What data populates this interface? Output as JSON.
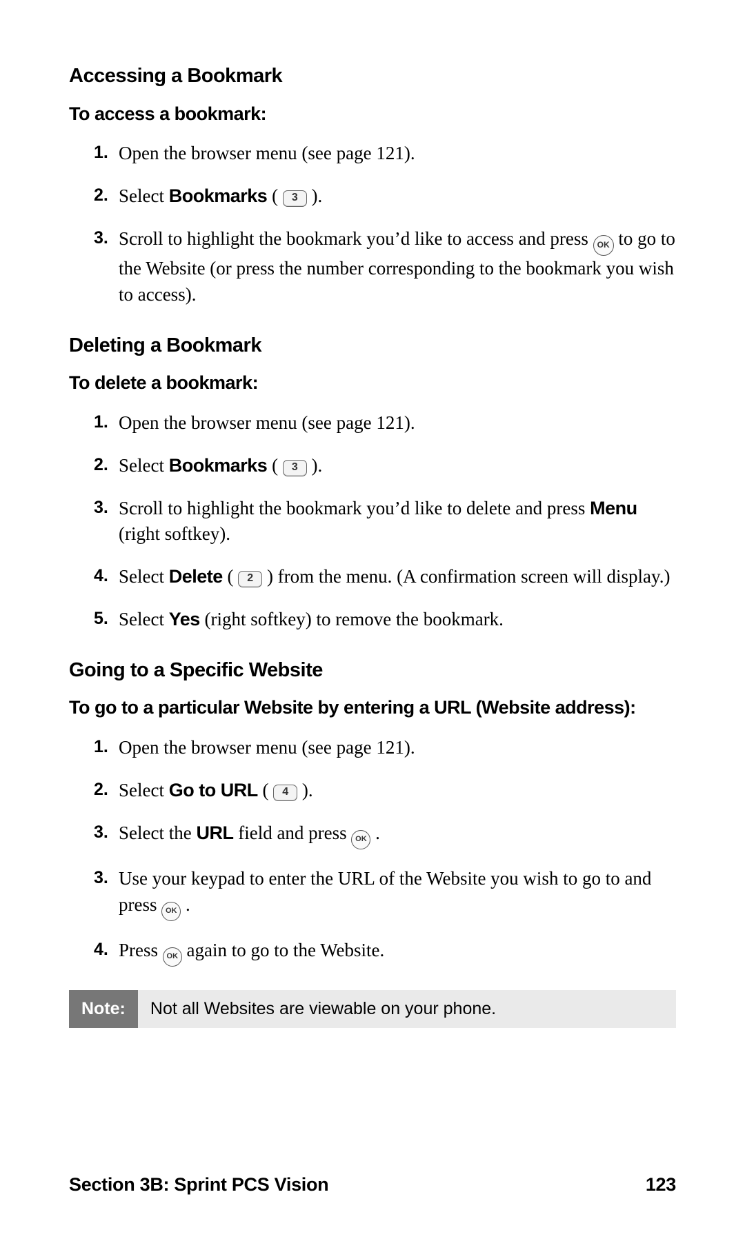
{
  "sectionA": {
    "heading": "Accessing a Bookmark",
    "intro": "To access a bookmark:",
    "steps": [
      {
        "num": "1.",
        "pre": "Open the browser menu (see page 121)."
      },
      {
        "num": "2.",
        "pre": "Select ",
        "bold": "Bookmarks",
        "key": "3",
        "post": " )."
      },
      {
        "num": "3.",
        "pre": "Scroll to highlight the bookmark you’d like to access and press ",
        "ok": "OK",
        "post2": " to go to the Website (or press the number corresponding to the bookmark you wish to access)."
      }
    ]
  },
  "sectionB": {
    "heading": "Deleting a Bookmark",
    "intro": "To delete a bookmark:",
    "steps": [
      {
        "num": "1.",
        "pre": "Open the browser menu (see page 121)."
      },
      {
        "num": "2.",
        "pre": "Select ",
        "bold": "Bookmarks",
        "key": "3",
        "post": " )."
      },
      {
        "num": "3.",
        "pre": "Scroll to highlight the bookmark you’d like to delete and press ",
        "bold2": "Menu",
        "post2": " (right softkey)."
      },
      {
        "num": "4.",
        "pre": "Select ",
        "bold": "Delete",
        "key": "2",
        "post": " ) from the menu. (A confirmation screen will display.)"
      },
      {
        "num": "5.",
        "pre": "Select ",
        "bold": "Yes",
        "post": " (right softkey) to remove the bookmark."
      }
    ]
  },
  "sectionC": {
    "heading": "Going to a Specific Website",
    "intro": "To go to a particular Website by entering a URL (Website address):",
    "steps": [
      {
        "num": "1.",
        "pre": "Open the browser menu (see page 121)."
      },
      {
        "num": "2.",
        "pre": "Select ",
        "bold": "Go to URL",
        "key": "4",
        "post": " )."
      },
      {
        "num": "3.",
        "pre": "Select the ",
        "bold": "URL",
        "post": " field and press ",
        "ok": "OK",
        "post2": " ."
      },
      {
        "num": "3.",
        "pre": "Use your keypad to enter the URL of the Website you wish to go to and press ",
        "ok": "OK",
        "post2": " ."
      },
      {
        "num": "4.",
        "pre": "Press ",
        "ok": "OK",
        "post2": " again to go to the Website."
      }
    ]
  },
  "note": {
    "label": "Note:",
    "text": "Not all Websites are viewable on your phone."
  },
  "footer": {
    "left": "Section 3B: Sprint PCS Vision",
    "right": "123"
  }
}
